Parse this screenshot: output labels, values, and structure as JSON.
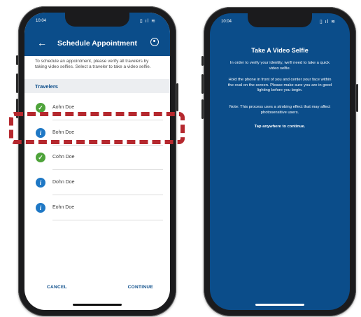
{
  "phone1": {
    "status": {
      "time": "10:04",
      "icons": "▯ ıl ≋"
    },
    "header": {
      "title": "Schedule Appointment"
    },
    "intro": "To schedule an appointment, please verify all travelers by taking video selfies. Select a traveler to take a video selfie.",
    "section": "Travelers",
    "travelers": [
      {
        "name": "Aohn Doe",
        "status": "verified"
      },
      {
        "name": "Bohn Doe",
        "status": "pending"
      },
      {
        "name": "Cohn Doe",
        "status": "verified"
      },
      {
        "name": "Dohn Doe",
        "status": "pending"
      },
      {
        "name": "Eohn Doe",
        "status": "pending"
      }
    ],
    "actions": {
      "cancel": "CANCEL",
      "continue": "CONTINUE"
    }
  },
  "phone2": {
    "status": {
      "time": "10:04",
      "icons": "▯ ıl ≋"
    },
    "title": "Take A Video Selfie",
    "paragraphs": [
      "In order to verify your identity, we'll need to take a quick video selfie.",
      "Hold the phone in front of you and center your face within the oval on the screen. Please make sure you are in good lighting before you begin.",
      "Note: This process uses a strobing effect that may affect photosensitive users."
    ],
    "tap": "Tap anywhere to continue."
  },
  "colors": {
    "primary": "#0b4d8a",
    "success": "#4ea33a",
    "info": "#1f78c5",
    "highlight": "#b5282e"
  },
  "glyphs": {
    "back": "←",
    "check": "✓",
    "info": "i"
  }
}
